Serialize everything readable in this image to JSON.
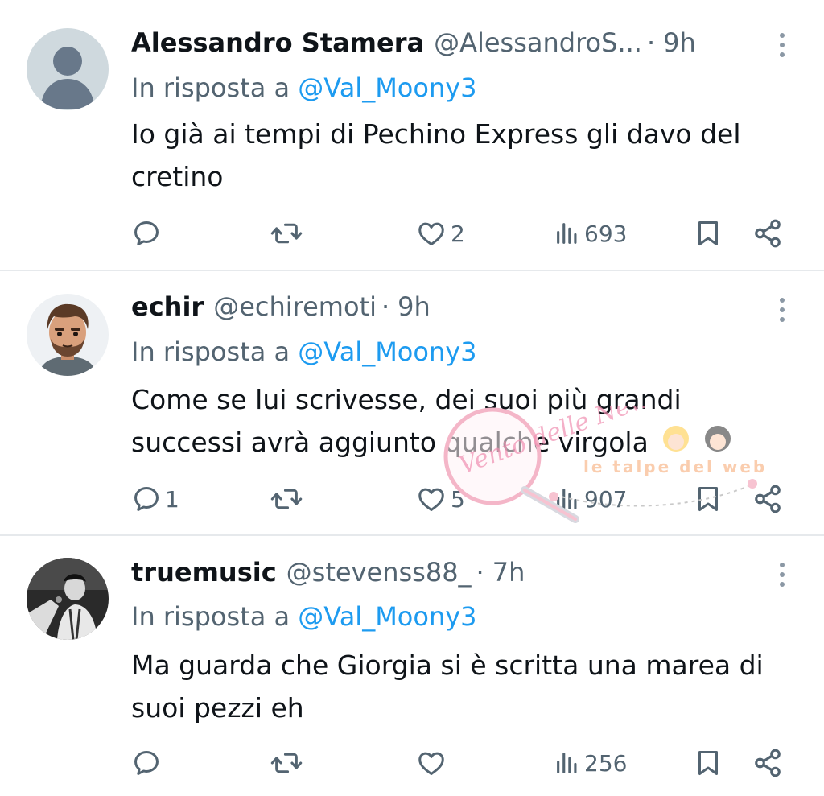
{
  "tweets": [
    {
      "name": "Alessandro Stamera",
      "handle": "@AlessandroS...",
      "separator": "·",
      "time": "9h",
      "reply_prefix": "In risposta a",
      "reply_mention": "@Val_Moony3",
      "lines": [
        "Io già ai tempi di Pechino Express gli davo del",
        "cretino"
      ],
      "replies": "",
      "retweets": "",
      "likes": "2",
      "views": "693",
      "avatar": "default-avatar-icon"
    },
    {
      "name": "echir",
      "handle": "@echiremoti",
      "separator": "·",
      "time": "9h",
      "reply_prefix": "In risposta a",
      "reply_mention": "@Val_Moony3",
      "lines": [
        "Come se lui scrivesse, dei suoi più grandi",
        "successi avrà aggiunto qualche virgola"
      ],
      "replies": "1",
      "retweets": "",
      "likes": "5",
      "views": "907",
      "avatar": "cartoon-man-avatar"
    },
    {
      "name": "truemusic",
      "handle": "@stevenss88_",
      "separator": "·",
      "time": "7h",
      "reply_prefix": "In risposta a",
      "reply_mention": "@Val_Moony3",
      "lines": [
        "Ma guarda che Giorgia si è scritta una marea di",
        "suoi pezzi eh"
      ],
      "replies": "",
      "retweets": "",
      "likes": "",
      "views": "256",
      "avatar": "bw-singer-photo-avatar"
    }
  ],
  "icons": {
    "reply": "reply-icon",
    "retweet": "retweet-icon",
    "like": "heart-icon",
    "views": "views-icon",
    "bookmark": "bookmark-icon",
    "share": "share-icon",
    "more": "more-vertical-icon"
  },
  "watermark": {
    "left_text": "Vento delle News",
    "right_text": "le talpe del web"
  },
  "colors": {
    "text": "#0f1419",
    "secondary": "#536471",
    "mention": "#1d9bf0",
    "divider": "#e6e9ec"
  }
}
